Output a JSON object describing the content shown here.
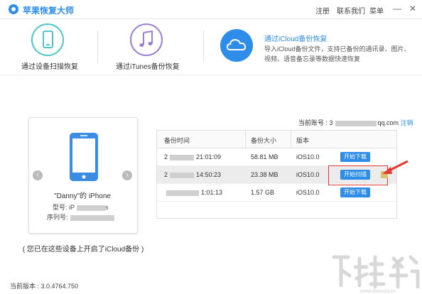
{
  "app": {
    "title": "苹果恢复大师"
  },
  "topmenu": {
    "register": "注册",
    "contact": "联系我们",
    "menu": "菜单"
  },
  "window_controls": {
    "minimize": "—",
    "close": "✕"
  },
  "modes": {
    "device_scan": {
      "label": "通过设备扫描恢复",
      "icon": "phone-icon"
    },
    "itunes": {
      "label": "通过iTunes备份恢复",
      "icon": "music-note-icon"
    },
    "icloud": {
      "label": "通过iCloud备份恢复",
      "icon": "cloud-icon",
      "description": "导入iCloud备份文件，支持已备份的通讯录、图片、视频、语音备忘录等数据快速恢复"
    }
  },
  "device": {
    "name": "\"Danny\"的 iPhone",
    "model_label": "型号: iP",
    "model_suffix": "s",
    "serial_label": "序列号:",
    "note": "( 您已在这些设备上开启了iCloud备份 )",
    "prev": "‹",
    "next": "›"
  },
  "account": {
    "label": "当前账号 : 3",
    "domain": "qq.com",
    "logout": "注销"
  },
  "table": {
    "headers": [
      "备份时间",
      "备份大小",
      "版本"
    ],
    "rows": [
      {
        "time_prefix": "2",
        "time": "21:01:09",
        "size": "58.81 MB",
        "version": "iOS10.0",
        "action": "开始下载",
        "selected": false
      },
      {
        "time_prefix": "2",
        "time": "14:50:23",
        "size": "23.38 MB",
        "version": "iOS10.0",
        "action": "开始扫描",
        "selected": true
      },
      {
        "time_prefix": "",
        "time": "1:01:13",
        "size": "1.57 GB",
        "version": "iOS10.0",
        "action": "开始下载",
        "selected": false
      }
    ]
  },
  "footer": {
    "version": "当前版本 : 3.0.4764.750"
  },
  "colors": {
    "accent": "#2e8de8",
    "highlight": "#e53935",
    "arrow": "#e53935"
  }
}
